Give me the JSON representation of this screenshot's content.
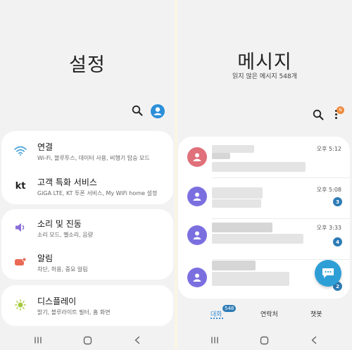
{
  "settings": {
    "title": "설정",
    "group1": [
      {
        "title": "연결",
        "subtitle": "Wi-Fi, 블루투스, 데이터 사용, 비행기 탑승 모드",
        "icon": "wifi-icon"
      },
      {
        "title": "고객 특화 서비스",
        "subtitle": "GiGA LTE, KT 투폰 서비스, My WiFi home 설정",
        "icon": "kt-logo-icon",
        "icon_text": "kt"
      }
    ],
    "group2": [
      {
        "title": "소리 및 진동",
        "subtitle": "소리 모드, 벨소리, 음량",
        "icon": "speaker-icon"
      },
      {
        "title": "알림",
        "subtitle": "차단, 허용, 중요 알림",
        "icon": "notification-icon"
      }
    ],
    "group3": [
      {
        "title": "디스플레이",
        "subtitle": "밝기, 블루라이트 필터, 홈 화면",
        "icon": "sun-icon"
      }
    ]
  },
  "messages": {
    "title": "메시지",
    "subtitle": "읽지 않은 메시지 548개",
    "more_badge": "N",
    "conversations": [
      {
        "time": "오후 5:12",
        "unread": "",
        "avatar_color": "#e0707a"
      },
      {
        "time": "오후 5:08",
        "unread": "3",
        "avatar_color": "#7b6fe0"
      },
      {
        "time": "오후 3:33",
        "unread": "4",
        "avatar_color": "#7b6fe0"
      },
      {
        "time": "",
        "unread": "2",
        "avatar_color": "#7b6fe0"
      }
    ],
    "tabs": {
      "conversations": "대화",
      "conversations_badge": "548",
      "contacts": "연락처",
      "chatbot": "챗봇"
    }
  },
  "colors": {
    "accent": "#2d7bb5",
    "fab": "#2e9fd6",
    "profile": "#2b8fd9",
    "badge_orange": "#f08a3c"
  }
}
